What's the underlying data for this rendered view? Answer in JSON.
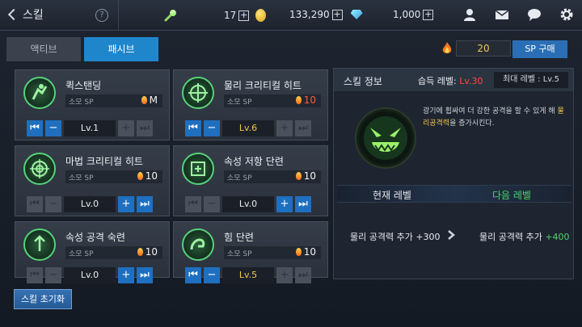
{
  "header": {
    "title": "스킬",
    "help": "?",
    "stamina": "17",
    "gold": "133,290",
    "gems": "1,000",
    "plus": "+"
  },
  "tabs": {
    "active": "액티브",
    "passive": "패시브"
  },
  "sp": {
    "value": "20",
    "buy_label": "SP 구매"
  },
  "cost_label": "소모 SP",
  "skills": [
    {
      "name": "퀵스탠딩",
      "cost": "M",
      "level": "Lv.1"
    },
    {
      "name": "물리 크리티컬 히트",
      "cost": "10",
      "level": "Lv.6"
    },
    {
      "name": "마법 크리티컬 히트",
      "cost": "10",
      "level": "Lv.0"
    },
    {
      "name": "속성 저항 단련",
      "cost": "10",
      "level": "Lv.0"
    },
    {
      "name": "속성 공격 숙련",
      "cost": "10",
      "level": "Lv.0"
    },
    {
      "name": "힘 단련",
      "cost": "10",
      "level": "Lv.5"
    }
  ],
  "reset_label": "스킬 초기화",
  "info": {
    "title": "스킬 정보",
    "learn_label": "습득 레벨:",
    "learn_value": "Lv.30",
    "max_level": "최대 레벨 : Lv.5",
    "desc_pre": "광기에 휩싸여 더 강한 공격을 할 수 있게 해 ",
    "desc_hl": "물리공격력",
    "desc_post": "을 증가시킨다.",
    "current_level": "현재 레벨",
    "next_level": "다음 레벨",
    "stat_current": "물리 공격력 추가 +300",
    "stat_next_label": "물리 공격력 추가",
    "stat_next_value": "+400"
  },
  "colors": {
    "accent_blue": "#1f86cc",
    "button_blue": "#1f6fc0",
    "gold_text": "#f3c54a",
    "red_text": "#ff4b3a",
    "green_text": "#4bd36a"
  }
}
